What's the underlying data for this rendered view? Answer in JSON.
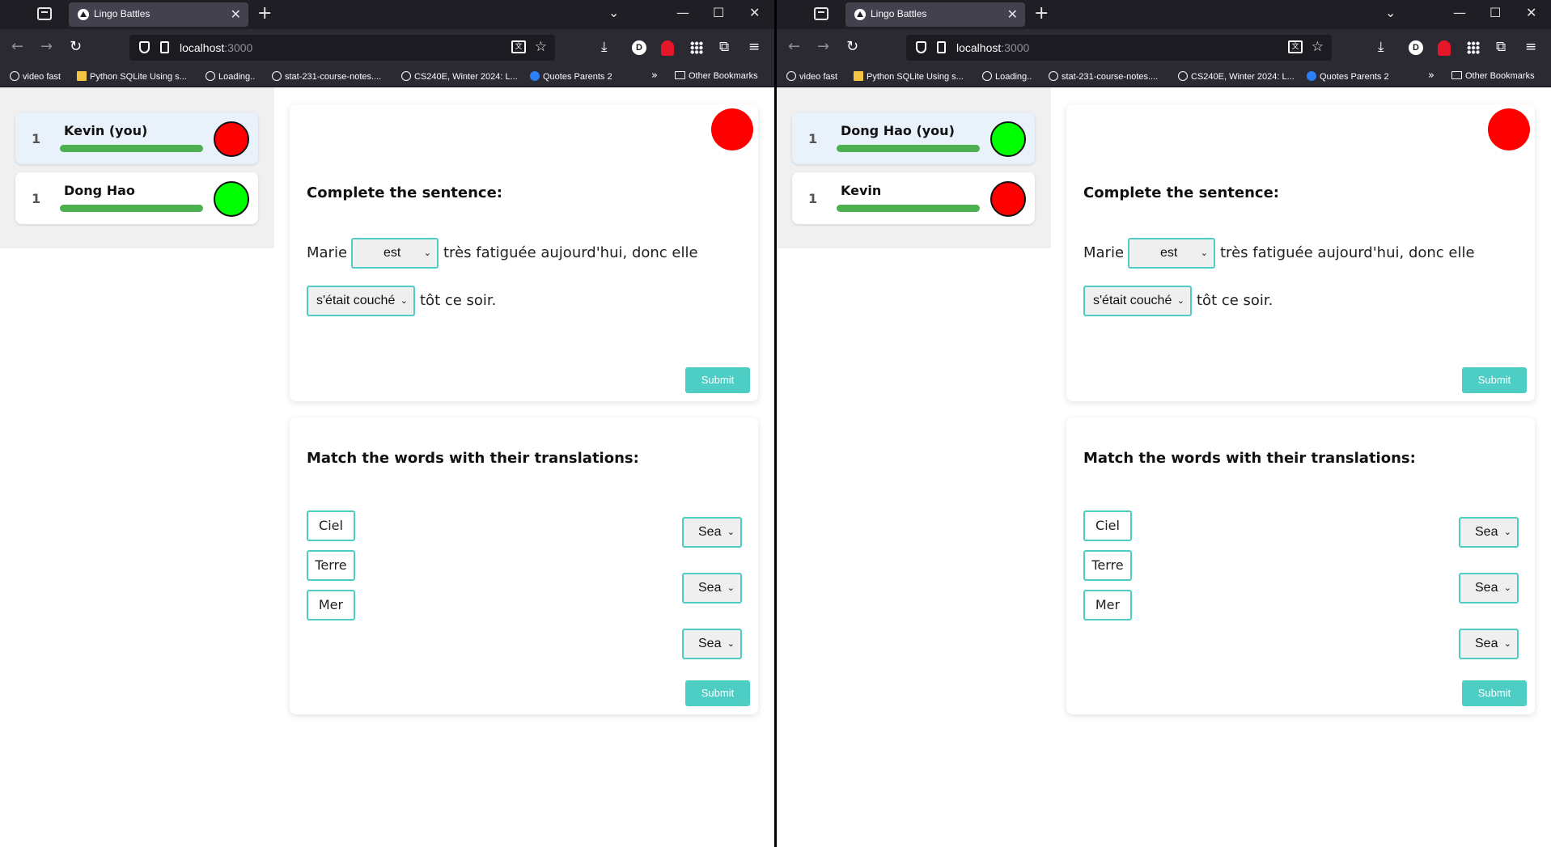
{
  "browser": {
    "tab_title": "Lingo Battles",
    "url_host": "localhost",
    "url_port": ":3000",
    "bookmarks": [
      "video fast",
      "Python SQLite Using s...",
      "Loading..",
      "stat-231-course-notes....",
      "CS240E, Winter 2024: L...",
      "Quotes Parents 2"
    ],
    "other_bookmarks": "Other Bookmarks",
    "avatar_letter": "D"
  },
  "colors": {
    "accent": "#4ecdc4",
    "progress": "#4caf50",
    "status_red": "#ff0000",
    "status_green": "#00ff00"
  },
  "windows": [
    {
      "players": [
        {
          "rank": "1",
          "name": "Kevin (you)",
          "status_color": "#ff0000",
          "progress": 1.0
        },
        {
          "rank": "1",
          "name": "Dong Hao",
          "status_color": "#00ff00",
          "progress": 1.0
        }
      ]
    },
    {
      "players": [
        {
          "rank": "1",
          "name": "Dong Hao (you)",
          "status_color": "#00ff00",
          "progress": 1.0
        },
        {
          "rank": "1",
          "name": "Kevin",
          "status_color": "#ff0000",
          "progress": 1.0
        }
      ]
    }
  ],
  "sentence": {
    "heading": "Complete the sentence:",
    "word_before": "Marie",
    "select1": "est",
    "text_middle": "très fatiguée aujourd'hui, donc elle",
    "select2": "s'était couché",
    "text_end": "tôt ce soir.",
    "submit": "Submit"
  },
  "match": {
    "heading": "Match the words with their translations:",
    "words": [
      "Ciel",
      "Terre",
      "Mer"
    ],
    "selects": [
      "Sea",
      "Sea",
      "Sea"
    ],
    "submit": "Submit"
  }
}
